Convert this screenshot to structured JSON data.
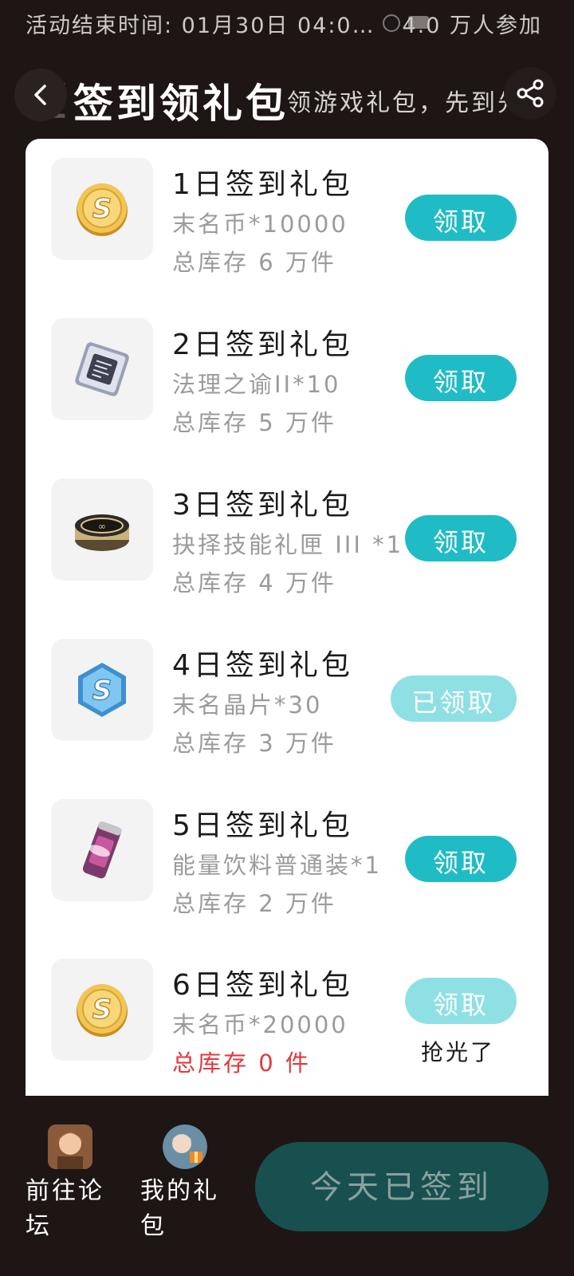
{
  "event": {
    "end_time": "活动结束时间: 01月30日 04:0…",
    "participants": "4.0 万人参加"
  },
  "header": {
    "title": "签到领礼包",
    "subtitle": "领游戏礼包，先到先得"
  },
  "gifts": [
    {
      "name": "1日签到礼包",
      "content": "末名币*10000",
      "stock": "总库存 6 万件",
      "button": "领取",
      "state": "available",
      "icon": "gold-coin-icon"
    },
    {
      "name": "2日签到礼包",
      "content": "法理之谕II*10",
      "stock": "总库存 5 万件",
      "button": "领取",
      "state": "available",
      "icon": "chip-card-icon"
    },
    {
      "name": "3日签到礼包",
      "content": "抉择技能礼匣 III *1",
      "stock": "总库存 4 万件",
      "button": "领取",
      "state": "available",
      "icon": "gift-box-icon"
    },
    {
      "name": "4日签到礼包",
      "content": "末名晶片*30",
      "stock": "总库存 3 万件",
      "button": "已领取",
      "state": "claimed",
      "icon": "hex-crystal-icon"
    },
    {
      "name": "5日签到礼包",
      "content": "能量饮料普通装*1",
      "stock": "总库存 2 万件",
      "button": "领取",
      "state": "available",
      "icon": "energy-can-icon"
    },
    {
      "name": "6日签到礼包",
      "content": "末名币*20000",
      "stock": "总库存 0 件",
      "button": "领取",
      "state": "sold_out",
      "note": "抢光了",
      "icon": "gold-coin-icon"
    }
  ],
  "bottom": {
    "forum_label": "前往论坛",
    "my_gifts_label": "我的礼包",
    "checkin_label": "今天已签到"
  },
  "colors": {
    "accent": "#1fbcc6",
    "accent_disabled": "#8ee0e5",
    "checkin_bg": "#17504f",
    "background": "#1d1614",
    "empty_stock": "#e0393e"
  }
}
